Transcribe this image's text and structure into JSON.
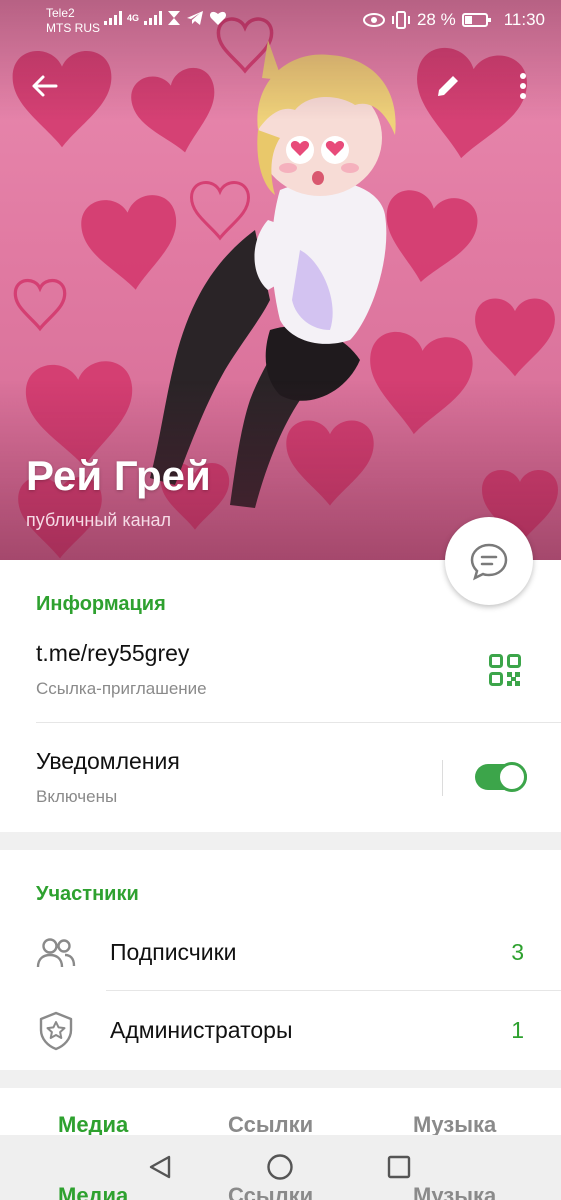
{
  "status_bar": {
    "carrier_1": "Tele2",
    "carrier_2": "MTS RUS",
    "network_badge": "4G",
    "battery_percent": "28 %",
    "time": "11:30"
  },
  "channel": {
    "name": "Рей Грей",
    "type": "публичный канал"
  },
  "info": {
    "section_title": "Информация",
    "link": "t.me/rey55grey",
    "link_caption": "Ссылка-приглашение",
    "notifications_label": "Уведомления",
    "notifications_state": "Включены",
    "notifications_enabled": true
  },
  "members": {
    "section_title": "Участники",
    "items": [
      {
        "label": "Подписчики",
        "count": "3",
        "icon": "people-icon"
      },
      {
        "label": "Администраторы",
        "count": "1",
        "icon": "admin-shield-icon"
      }
    ]
  },
  "tabs": [
    {
      "label": "Медиа",
      "active": true
    },
    {
      "label": "Ссылки",
      "active": false
    },
    {
      "label": "Музыка",
      "active": false
    }
  ],
  "colors": {
    "accent_green": "#2ea12f",
    "toggle_green": "#3ca54a",
    "cover_pink": "#e17aa2",
    "heart_red": "#d3366b"
  },
  "icons": {
    "back": "arrow-left-icon",
    "edit": "pencil-icon",
    "more": "more-vertical-icon",
    "comment": "chat-bubble-icon",
    "qr": "qr-code-icon",
    "nav_back": "triangle-back-icon",
    "nav_home": "circle-home-icon",
    "nav_recents": "square-recents-icon"
  }
}
